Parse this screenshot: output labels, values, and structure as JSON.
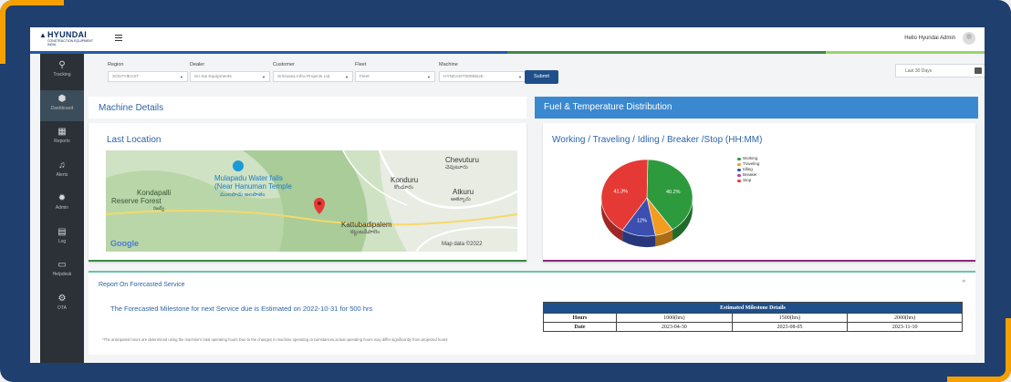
{
  "header": {
    "logo_name": "HYUNDAI",
    "logo_sub": "CONSTRUCTION EQUIPMENT INDIA",
    "greeting": "Hello Hyundai Admin"
  },
  "accent_colors": [
    "#1e5ca8",
    "#1e5ca8",
    "#1e5ca8",
    "#3c8a45",
    "#3c8a45",
    "#9bd36a"
  ],
  "sidebar": {
    "items": [
      {
        "label": "Tracking",
        "icon": "location-pin-icon",
        "glyph": "⚲",
        "active": false
      },
      {
        "label": "Dashboard",
        "icon": "dashboard-icon",
        "glyph": "⬢",
        "active": true
      },
      {
        "label": "Reports",
        "icon": "reports-icon",
        "glyph": "▦",
        "active": false
      },
      {
        "label": "Alerts",
        "icon": "bell-icon",
        "glyph": "♫",
        "active": false
      },
      {
        "label": "Admin",
        "icon": "gear-icon",
        "glyph": "✹",
        "active": false
      },
      {
        "label": "Log",
        "icon": "log-icon",
        "glyph": "▤",
        "active": false
      },
      {
        "label": "Helpdesk",
        "icon": "monitor-icon",
        "glyph": "▭",
        "active": false
      },
      {
        "label": "OTA",
        "icon": "settings-cog-icon",
        "glyph": "⚙",
        "active": false
      }
    ]
  },
  "filters": {
    "region": {
      "label": "Region",
      "value": "SOUTHEAST"
    },
    "dealer": {
      "label": "Dealer",
      "value": "Sri Sai Equipments"
    },
    "customer": {
      "label": "Customer",
      "value": "Srinivasa Infra Projects Ltd"
    },
    "fleet": {
      "label": "Fleet",
      "value": "Fleet"
    },
    "machine": {
      "label": "Machine",
      "value": "HYNDAI0T00965UE"
    },
    "submit_label": "Submit",
    "date_range": "Last 30 Days"
  },
  "machine_details": {
    "title": "Machine Details",
    "last_location_title": "Last Location",
    "map_labels": {
      "place1": "Chevuturu",
      "place1_local": "చెవుటూరు",
      "place2": "Mulapadu Water falls",
      "place2b": "(Near Hanuman Temple",
      "place2_local": "ములపాడు జలపాతం",
      "place3": "Konduru",
      "place3_local": "కొండూరు",
      "place4": "Kondapalli",
      "place4b": "Reserve Forest",
      "place4_local": "రిజర్వ్",
      "place5": "Atkuru",
      "place5_local": "ఆత్కూరు",
      "place6": "Kattubadipalem",
      "place6_local": "కట్టుబడిపాలెం",
      "google": "Google",
      "map_data": "Map data ©2022"
    }
  },
  "fuel_temp": {
    "title": "Fuel & Temperature Distribution",
    "chart_title": "Working / Traveling / Idling / Breaker /Stop (HH:MM)"
  },
  "chart_data": {
    "type": "pie",
    "title": "Working / Traveling / Idling / Breaker /Stop (HH:MM)",
    "legend_position": "right",
    "series": [
      {
        "name": "Working",
        "value": 40.2,
        "color": "#2e9a3e",
        "label": "40.2%"
      },
      {
        "name": "Traveling",
        "value": 6.5,
        "color": "#f39c1f",
        "label": ""
      },
      {
        "name": "Idling",
        "value": 12,
        "color": "#3a4fb0",
        "label": "12%"
      },
      {
        "name": "Breaker",
        "value": 0,
        "color": "#b040b0",
        "label": ""
      },
      {
        "name": "Stop",
        "value": 41.3,
        "color": "#e53935",
        "label": "41.3%"
      }
    ]
  },
  "report": {
    "title": "Report On Forecasted Service",
    "message": "The Forecasted Milestone for next Service due is Estimated on 2022-10-31 for 500 hrs",
    "note": "*The anticipated hours are determined using the machine's total operating hours Due to the changes in machine operating circumstances,actual operating hours may differ significantly from projected hours",
    "table": {
      "caption": "Estimated Milestone Details",
      "row_headers": [
        "Hours",
        "Date"
      ],
      "hours": [
        "1000(hrs)",
        "1500(hrs)",
        "2000(hrs)"
      ],
      "dates": [
        "2023-04-30",
        "2023-08-05",
        "2023-11-10"
      ]
    }
  }
}
